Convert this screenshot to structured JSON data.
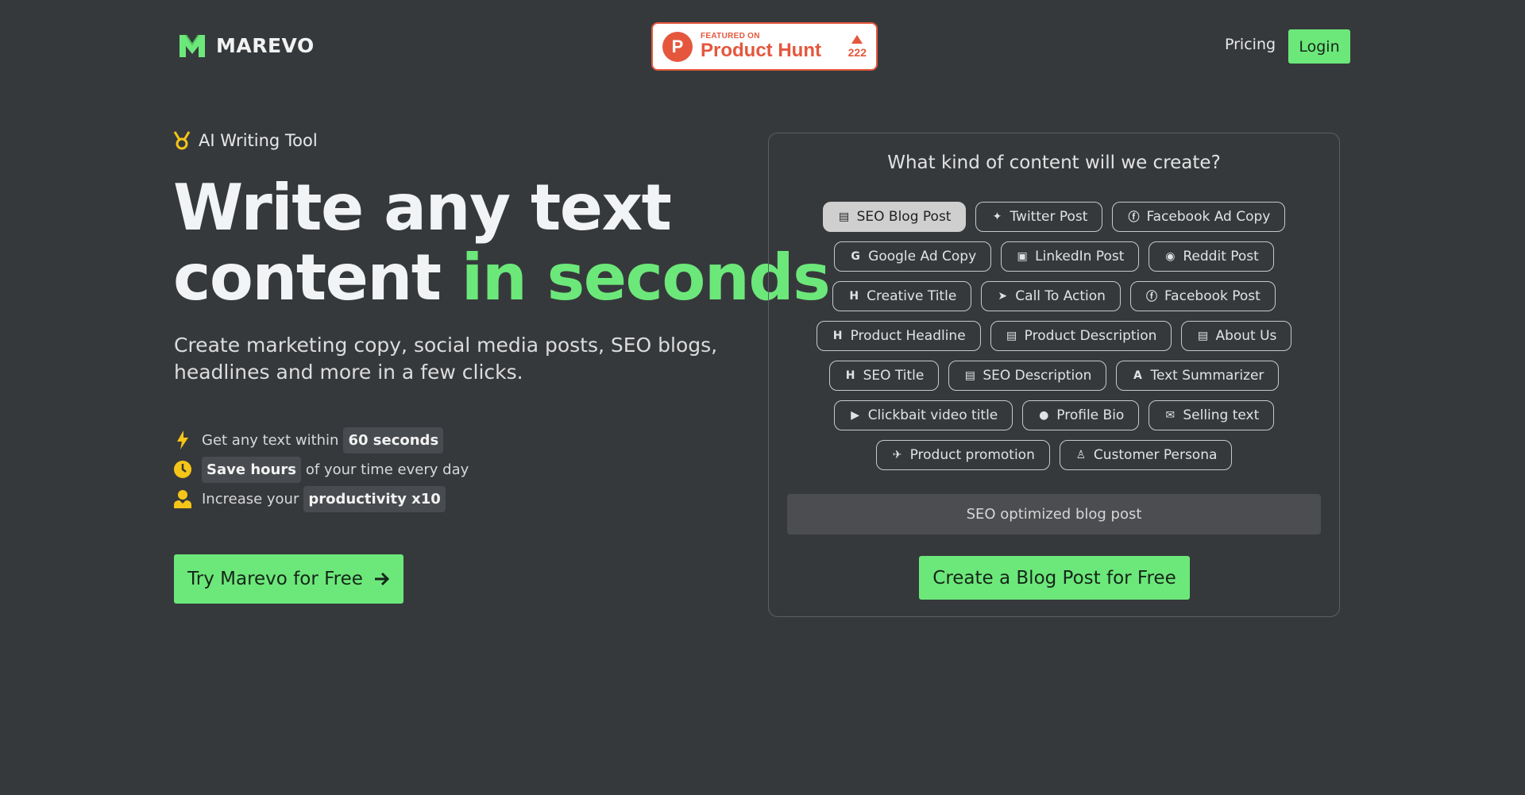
{
  "header": {
    "logo_text": "MAREVO",
    "product_hunt": {
      "featured": "FEATURED ON",
      "name": "Product Hunt",
      "votes": "222"
    },
    "nav": {
      "pricing": "Pricing",
      "login": "Login"
    }
  },
  "hero": {
    "tag": "AI Writing Tool",
    "title_line1": "Write any text",
    "title_line2_plain": "content ",
    "title_line2_green": "in seconds",
    "subtitle": "Create marketing copy, social media posts, SEO blogs, headlines and more in a few clicks.",
    "benefits": [
      {
        "icon": "bolt-icon",
        "before": "Get any text within",
        "highlight": "60 seconds",
        "after": ""
      },
      {
        "icon": "clock-icon",
        "before": "",
        "highlight": "Save hours",
        "after": "of your time every day"
      },
      {
        "icon": "user-icon",
        "before": "Increase your",
        "highlight": "productivity x10",
        "after": ""
      }
    ],
    "cta": "Try Marevo for Free"
  },
  "card": {
    "title": "What kind of content will we create?",
    "chips": [
      [
        "SEO Blog Post",
        "Twitter Post",
        "Facebook Ad Copy"
      ],
      [
        "Google Ad Copy",
        "LinkedIn Post",
        "Reddit Post"
      ],
      [
        "Creative Title",
        "Call To Action",
        "Facebook Post"
      ],
      [
        "Product Headline",
        "Product Description",
        "About Us"
      ],
      [
        "SEO Title",
        "SEO Description",
        "Text Summarizer"
      ],
      [
        "Clickbait video title",
        "Profile Bio",
        "Selling text"
      ],
      [
        "Product promotion",
        "Customer Persona"
      ]
    ],
    "active_chip": "SEO Blog Post",
    "input_value": "SEO optimized blog post",
    "cta": "Create a Blog Post for Free"
  },
  "colors": {
    "accent": "#6ce87a",
    "background": "#36393c",
    "product_hunt": "#e4573d"
  }
}
